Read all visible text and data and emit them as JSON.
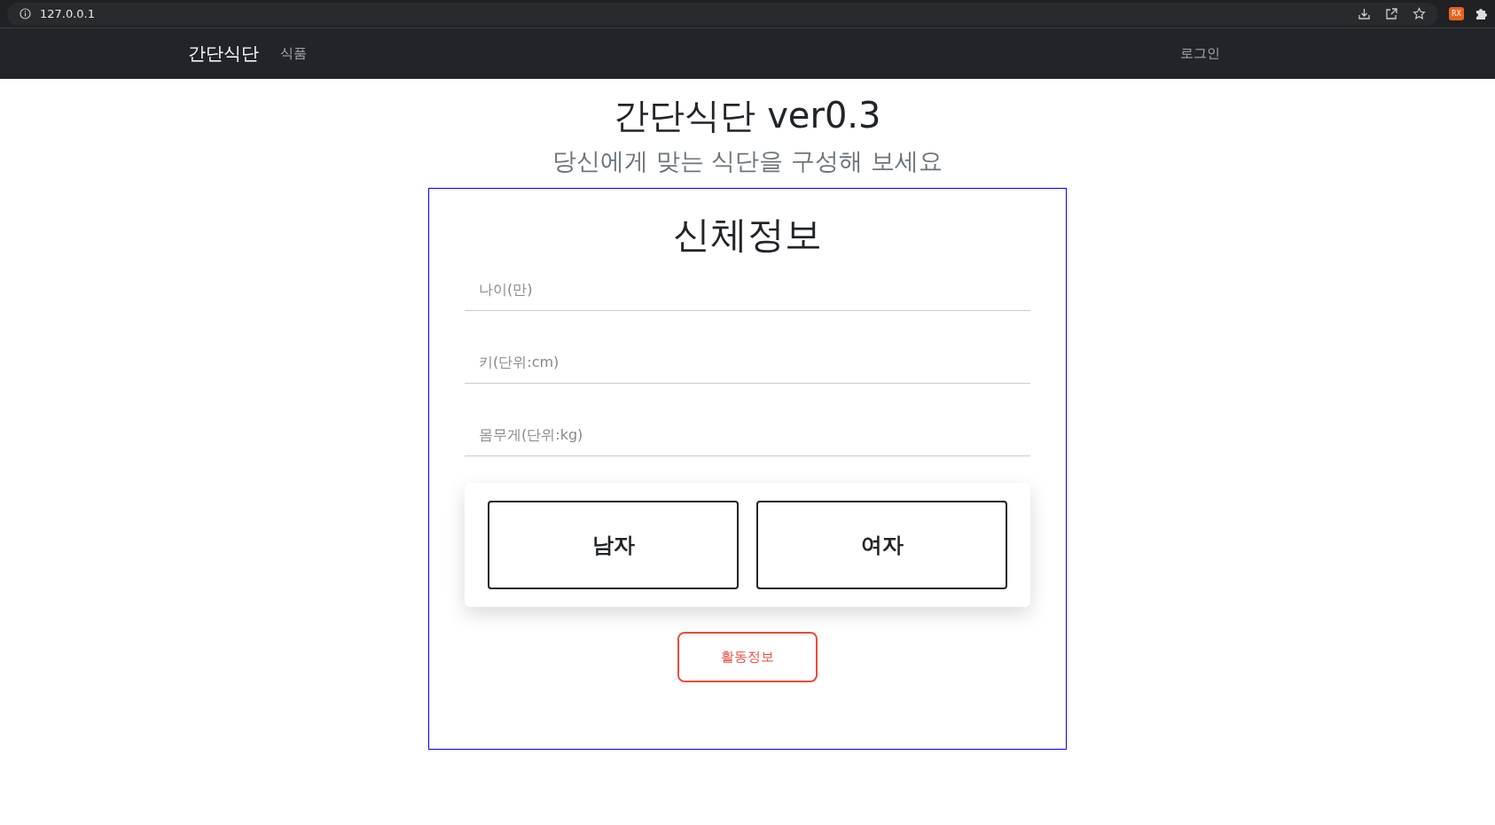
{
  "browser": {
    "url": "127.0.0.1",
    "extension_badge": "RX"
  },
  "navbar": {
    "brand": "간단식단",
    "links": [
      {
        "label": "식품"
      }
    ],
    "login": "로그인"
  },
  "header": {
    "title": "간단식단 ver0.3",
    "subtitle": "당신에게 맞는 식단을 구성해 보세요"
  },
  "form": {
    "title": "신체정보",
    "fields": [
      {
        "placeholder": "나이(만)"
      },
      {
        "placeholder": "키(단위:cm)"
      },
      {
        "placeholder": "몸무게(단위:kg)"
      }
    ],
    "gender_options": [
      {
        "label": "남자",
        "selected": false
      },
      {
        "label": "여자",
        "selected": false
      }
    ],
    "next_button": "활동정보"
  }
}
